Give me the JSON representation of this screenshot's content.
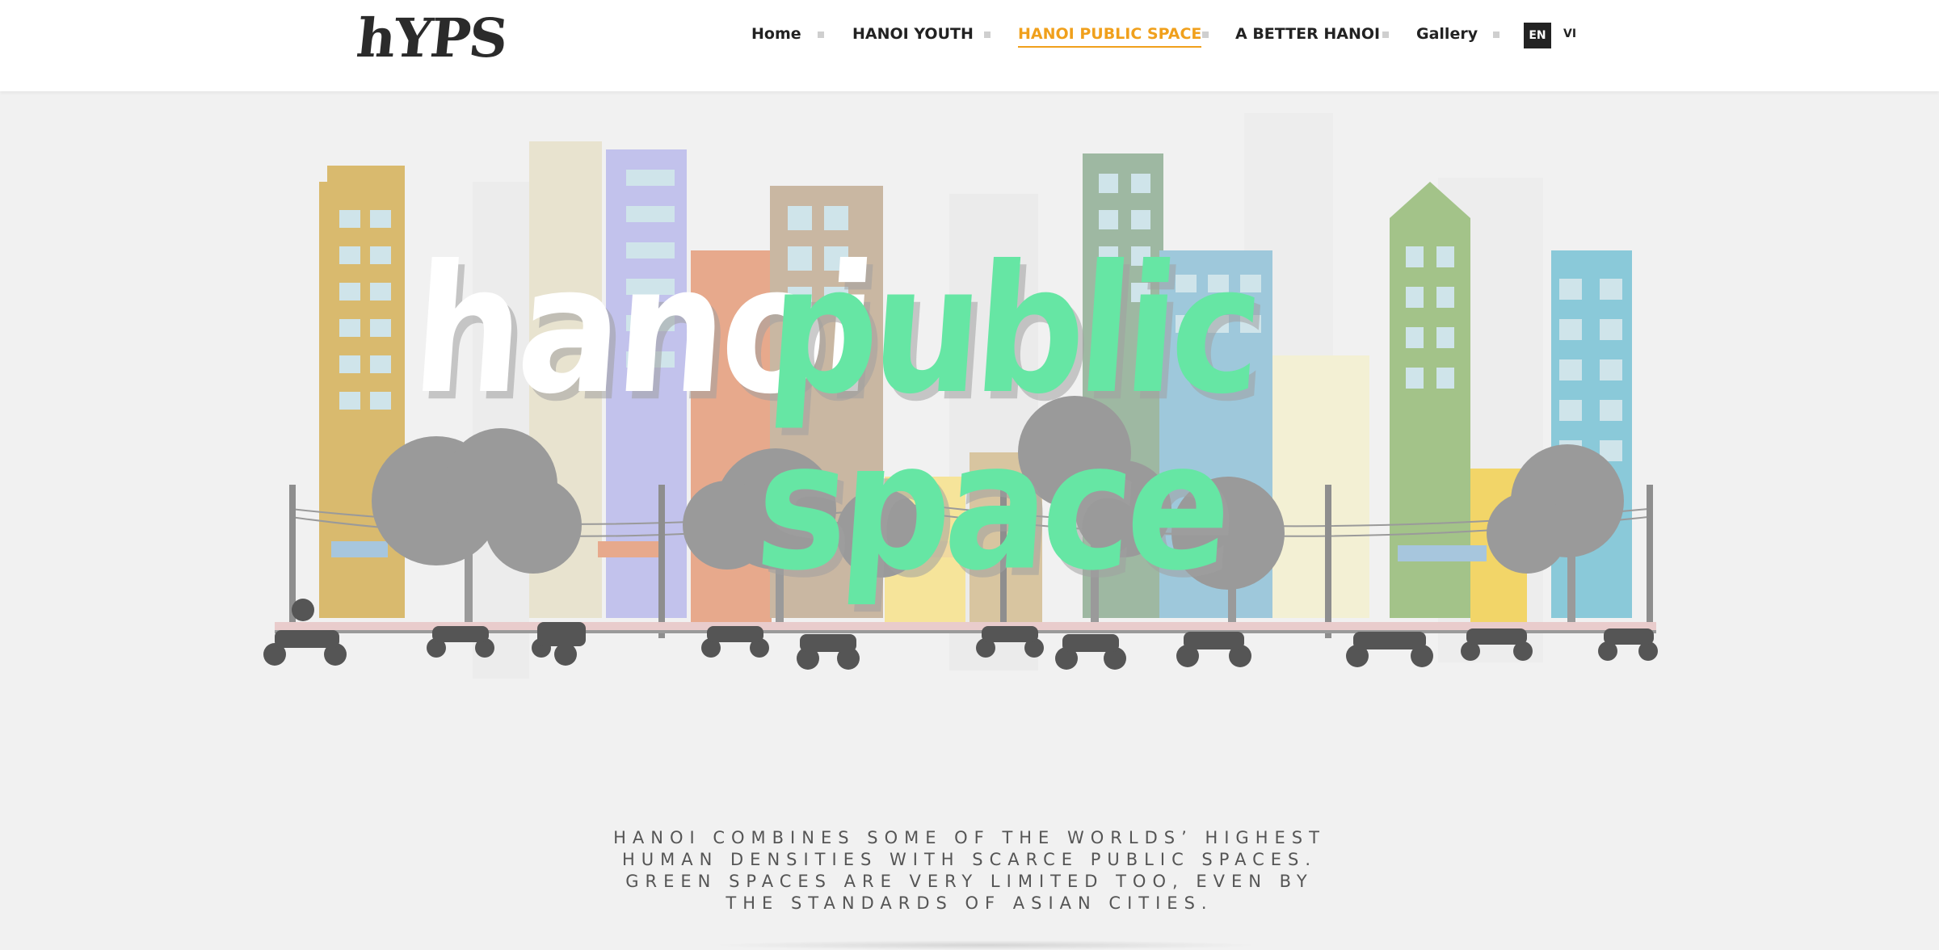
{
  "logo": {
    "text": "hYPS"
  },
  "nav": {
    "home": "Home",
    "hanoi_youth": "HANOI YOUTH",
    "hanoi_public_space": "HANOI PUBLIC SPACE",
    "a_better_hanoi": "A BETTER HANOI",
    "gallery": "Gallery",
    "active": "HANOI PUBLIC SPACE"
  },
  "language": {
    "en": "EN",
    "vi": "VI",
    "selected": "EN"
  },
  "hero": {
    "title_word1": "hanoi",
    "title_word2": "public space",
    "title_colors": {
      "word1": "#ffffff",
      "word2": "#66e6a4"
    }
  },
  "intro": {
    "lines": [
      "HANOI COMBINES SOME OF THE WORLDS’ HIGHEST",
      "HUMAN DENSITIES WITH SCARCE PUBLIC SPACES.",
      "GREEN SPACES ARE VERY LIMITED TOO, EVEN BY",
      "THE STANDARDS OF ASIAN CITIES."
    ]
  },
  "colors": {
    "accent": "#f0a01c",
    "background": "#f1f1f1",
    "header": "#ffffff"
  }
}
